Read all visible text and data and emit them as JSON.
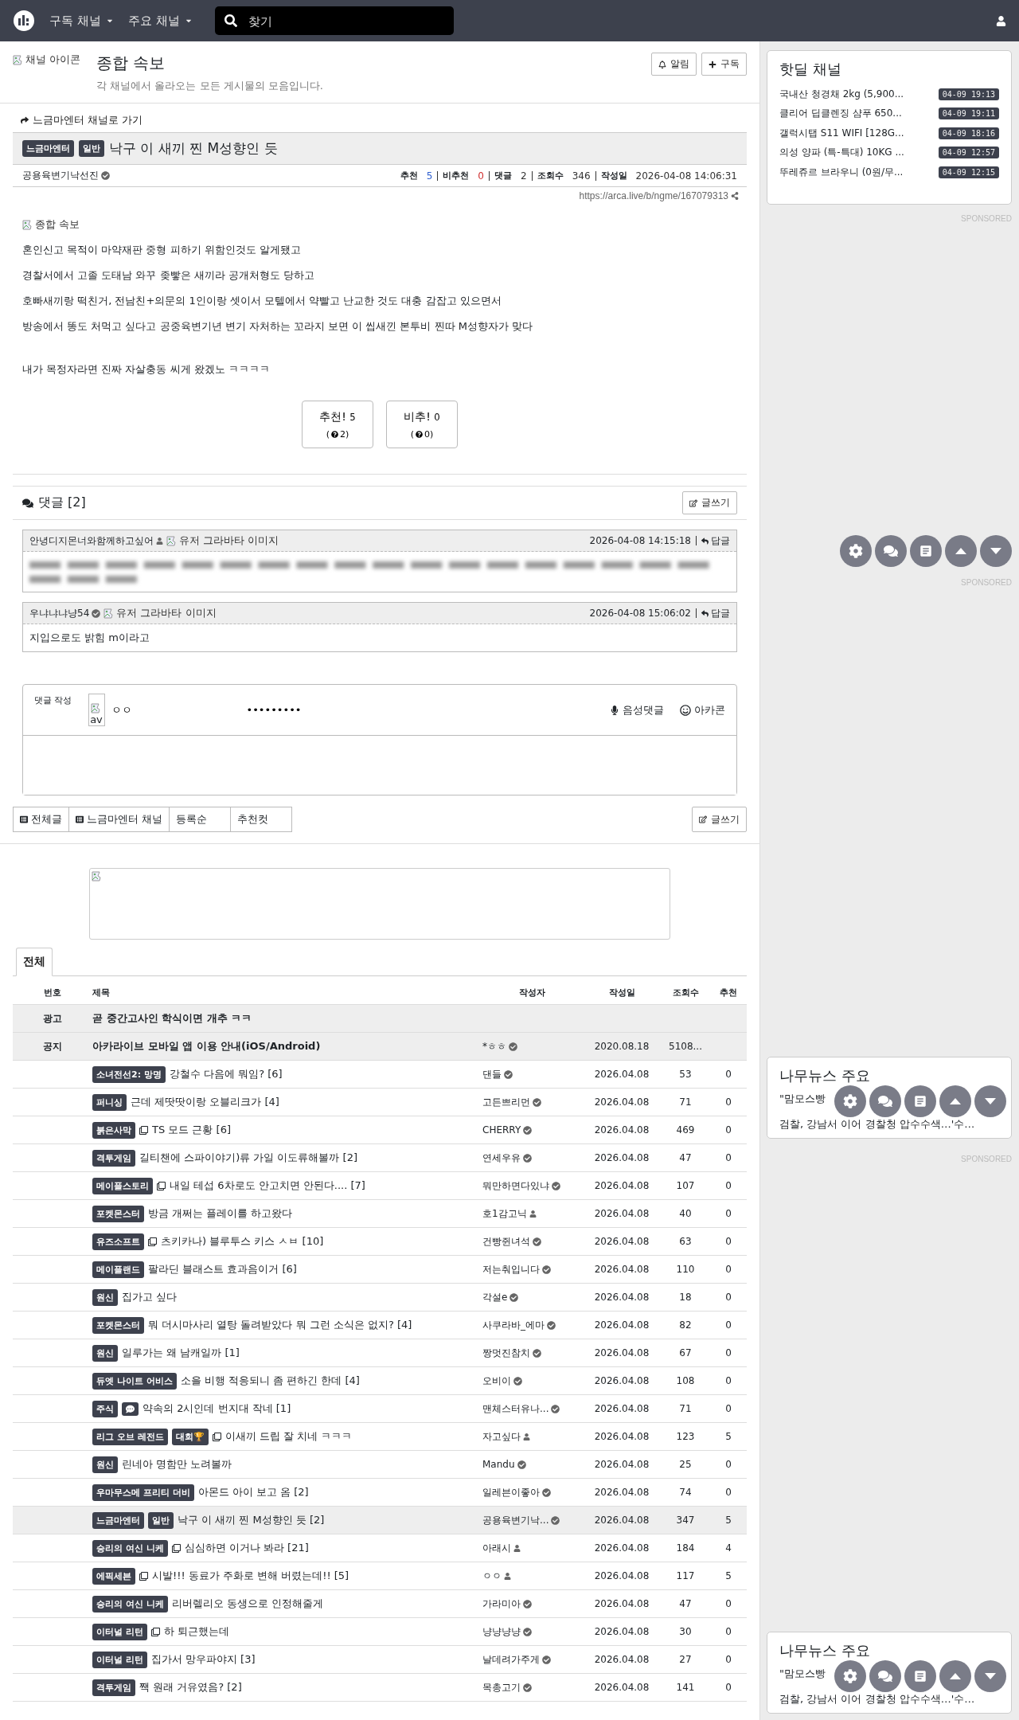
{
  "top_nav": {
    "menus": [
      "구독 채널",
      "주요 채널"
    ],
    "search": {
      "placeholder": "찾기"
    }
  },
  "channel": {
    "icon_alt": "채널 아이콘",
    "title": "종합 속보",
    "description": "각 채널에서 올라오는 모든 게시물의 모음입니다.",
    "buttons": [
      {
        "kind": "bell",
        "label": "알림"
      },
      {
        "kind": "plus",
        "label": "구독"
      }
    ]
  },
  "article": {
    "back_link": "느금마엔터 채널로 가기",
    "badges": [
      "느금마엔터",
      "일반"
    ],
    "title": "낙구 이 새끼 찐 M성향인 듯",
    "author": "공용육변기낙선진",
    "verified": true,
    "stats": [
      {
        "label": "추천",
        "value": "5",
        "kind": "up"
      },
      {
        "label": "비추천",
        "value": "0",
        "kind": "down"
      },
      {
        "label": "댓글",
        "value": "2",
        "kind": "plain"
      },
      {
        "label": "조회수",
        "value": "346",
        "kind": "plain"
      },
      {
        "label": "작성일",
        "value": "2026-04-08 14:06:31",
        "kind": "plain"
      }
    ],
    "url": "https://arca.live/b/ngme/167079313",
    "image_alt": "종합 속보",
    "paragraphs": [
      "혼인신고 목적이 마약재판 중형 피하기 위함인것도 알게됐고",
      "경찰서에서 고졸 도태남 와꾸 좆빻은 새끼라 공개처형도 당하고",
      "호빠새끼랑 떡친거, 전남친+의문의 1인이랑 셋이서 모텔에서 약빨고 난교한 것도 대충 감잡고 있으면서",
      "방송에서 똥도 처먹고 싶다고 공중육변기년 변기 자처하는 꼬라지 보면 이 씹새낀 본투비 찐따 M성향자가 맞다",
      "내가 목정자라면 진짜 자살충동 씨게 왔겠노 ㅋㅋㅋㅋ"
    ],
    "votes": [
      {
        "label": "추천!",
        "count": "5",
        "open": "(",
        "sub": "2)"
      },
      {
        "label": "비추!",
        "count": "0",
        "open": "(",
        "sub": "0)"
      }
    ]
  },
  "comments": {
    "title": "댓글 [2]",
    "write_button": "글쓰기",
    "items": [
      {
        "author": "안녕디지몬너와함께하고싶어",
        "verified": false,
        "avatar_alt": "유저 그라바타 이미지",
        "date": "2026-04-08 14:15:18",
        "reply": "답글",
        "blurred": true
      },
      {
        "author": "우냐냐냐냥54",
        "verified": true,
        "avatar_alt": "유저 그라바타 이미지",
        "date": "2026-04-08 15:06:02",
        "reply": "답글",
        "blurred": false,
        "text": "지입으로도 밝힘 m이라고"
      }
    ]
  },
  "comment_form": {
    "label": "댓글 작성",
    "avatar_alt": "av",
    "nickname": "ㅇㅇ",
    "password": "•••••••••",
    "voice": "음성댓글",
    "arcacon": "아카콘"
  },
  "bottom_tabs": {
    "items": [
      {
        "label": "전체글",
        "kind": "list"
      },
      {
        "label": "느금마엔터 채널",
        "kind": "list"
      },
      {
        "label": "등록순",
        "kind": "plain"
      },
      {
        "label": "추천컷",
        "kind": "plain"
      }
    ],
    "write_button": "글쓰기"
  },
  "board": {
    "tabs": [
      {
        "label": "전체",
        "selected": true
      }
    ],
    "columns": [
      "번호",
      "제목",
      "작성자",
      "작성일",
      "조회수",
      "추천"
    ],
    "pinned": [
      {
        "label": "광고",
        "title": "곧 중간고사인 학식이면 개추 ㅋㅋ"
      },
      {
        "label": "공지",
        "title": "아카라이브 모바일 앱 이용 안내(iOS/Android)",
        "author": "*ㅎㅎ",
        "verified": true,
        "date": "2020.08.18",
        "views": "5108..."
      }
    ],
    "rows": [
      {
        "badges": [
          {
            "kind": "text",
            "text": "소녀전선2: 망명"
          }
        ],
        "image": false,
        "title": "강철수 다음에 뭐임? [6]",
        "author": "댄들",
        "verified": true,
        "date": "2026.04.08",
        "views": "53",
        "votes": "0",
        "current": false
      },
      {
        "badges": [
          {
            "kind": "text",
            "text": "퍼니싱"
          }
        ],
        "image": false,
        "title": "근데 제땃땃이랑 오블리크가 [4]",
        "author": "고든쁘리먼",
        "verified": true,
        "date": "2026.04.08",
        "views": "71",
        "votes": "0",
        "current": false
      },
      {
        "badges": [
          {
            "kind": "text",
            "text": "붉은사막"
          }
        ],
        "image": true,
        "title": "TS 모드 근황 [6]",
        "author": "CHERRY",
        "verified": true,
        "date": "2026.04.08",
        "views": "469",
        "votes": "0",
        "current": false
      },
      {
        "badges": [
          {
            "kind": "text",
            "text": "격투게임"
          }
        ],
        "image": false,
        "title": "길티챈에 스파이야기)류 가일 이도류해볼까 [2]",
        "author": "연세우유",
        "verified": true,
        "date": "2026.04.08",
        "views": "47",
        "votes": "0",
        "current": false
      },
      {
        "badges": [
          {
            "kind": "text",
            "text": "메이플스토리"
          }
        ],
        "image": true,
        "title": "내일 테섭 6차로도 안고치면 안된다.... [7]",
        "author": "뭐만하면다있냐",
        "verified": true,
        "date": "2026.04.08",
        "views": "107",
        "votes": "0",
        "current": false
      },
      {
        "badges": [
          {
            "kind": "text",
            "text": "포켓몬스터"
          }
        ],
        "image": false,
        "title": "방금 개쩌는 플레이를 하고왔다",
        "author": "호1감고닉",
        "verified": false,
        "date": "2026.04.08",
        "views": "40",
        "votes": "0",
        "current": false
      },
      {
        "badges": [
          {
            "kind": "text",
            "text": "유즈소프트"
          }
        ],
        "image": true,
        "title": "츠키카나) 블루투스 키스 ㅅㅂ [10]",
        "author": "건빵쥔녀석",
        "verified": true,
        "date": "2026.04.08",
        "views": "63",
        "votes": "0",
        "current": false
      },
      {
        "badges": [
          {
            "kind": "text",
            "text": "메이플랜드"
          }
        ],
        "image": false,
        "title": "팔라딘 블래스트 효과음이거 [6]",
        "author": "저는춰입니다",
        "verified": true,
        "date": "2026.04.08",
        "views": "110",
        "votes": "0",
        "current": false
      },
      {
        "badges": [
          {
            "kind": "text",
            "text": "원신"
          }
        ],
        "image": false,
        "title": "집가고 싶다",
        "author": "각설e",
        "verified": true,
        "date": "2026.04.08",
        "views": "18",
        "votes": "0",
        "current": false
      },
      {
        "badges": [
          {
            "kind": "text",
            "text": "포켓몬스터"
          }
        ],
        "image": false,
        "title": "뭐 더시마사리 열탕 돌려받았다 뭐 그런 소식은 없지? [4]",
        "author": "사쿠라바_에마",
        "verified": true,
        "date": "2026.04.08",
        "views": "82",
        "votes": "0",
        "current": false
      },
      {
        "badges": [
          {
            "kind": "text",
            "text": "원신"
          }
        ],
        "image": false,
        "title": "일루가는 왜 남캐일까 [1]",
        "author": "짱멋진참치",
        "verified": true,
        "date": "2026.04.08",
        "views": "67",
        "votes": "0",
        "current": false
      },
      {
        "badges": [
          {
            "kind": "text",
            "text": "듀엣 나이트 어비스"
          }
        ],
        "image": false,
        "title": "소을 비행 적응되니 좀 편하긴 한데 [4]",
        "author": "오비이",
        "verified": true,
        "date": "2026.04.08",
        "views": "108",
        "votes": "0",
        "current": false
      },
      {
        "badges": [
          {
            "kind": "text",
            "text": "주식"
          },
          {
            "kind": "chat"
          }
        ],
        "image": false,
        "title": "약속의 2시인데 번지대 작네 [1]",
        "author": "맨체스터유나...",
        "verified": true,
        "date": "2026.04.08",
        "views": "71",
        "votes": "0",
        "current": false
      },
      {
        "badges": [
          {
            "kind": "text",
            "text": "리그 오브 레전드"
          },
          {
            "kind": "text",
            "text": "대회🏆"
          }
        ],
        "image": true,
        "title": "이새끼 드립 잘 치네 ㅋㅋㅋ",
        "author": "자고싶다",
        "verified": false,
        "date": "2026.04.08",
        "views": "123",
        "votes": "5",
        "current": false
      },
      {
        "badges": [
          {
            "kind": "text",
            "text": "원신"
          }
        ],
        "image": false,
        "title": "린네아 명함만 노려볼까",
        "author": "Mandu",
        "verified": true,
        "date": "2026.04.08",
        "views": "25",
        "votes": "0",
        "current": false
      },
      {
        "badges": [
          {
            "kind": "text",
            "text": "우마무스메 프리티 더비"
          }
        ],
        "image": false,
        "title": "아몬드 아이 보고 옴 [2]",
        "author": "일레븐이좋아",
        "verified": true,
        "date": "2026.04.08",
        "views": "74",
        "votes": "0",
        "current": false
      },
      {
        "badges": [
          {
            "kind": "text",
            "text": "느금마엔터"
          },
          {
            "kind": "text",
            "text": "일반"
          }
        ],
        "image": false,
        "title": "낙구 이 새끼 찐 M성향인 듯 [2]",
        "author": "공용육변기낙...",
        "verified": true,
        "date": "2026.04.08",
        "views": "347",
        "votes": "5",
        "current": true
      },
      {
        "badges": [
          {
            "kind": "text",
            "text": "승리의 여신 니케"
          }
        ],
        "image": true,
        "title": "심심하면 이거나 봐라 [21]",
        "author": "아래시",
        "verified": false,
        "date": "2026.04.08",
        "views": "184",
        "votes": "4",
        "current": false
      },
      {
        "badges": [
          {
            "kind": "text",
            "text": "에픽세븐"
          }
        ],
        "image": true,
        "title": "시발!!! 동료가 주화로 변해 버렸는데!! [5]",
        "author": "ㅇㅇ",
        "verified": false,
        "date": "2026.04.08",
        "views": "117",
        "votes": "5",
        "current": false
      },
      {
        "badges": [
          {
            "kind": "text",
            "text": "승리의 여신 니케"
          }
        ],
        "image": false,
        "title": "리버렐리오 동생으로 인정해줄게",
        "author": "가라미아",
        "verified": true,
        "date": "2026.04.08",
        "views": "47",
        "votes": "0",
        "current": false
      },
      {
        "badges": [
          {
            "kind": "text",
            "text": "이터널 리턴"
          }
        ],
        "image": true,
        "title": "하 퇴근했는데",
        "author": "냥냥냥냥",
        "verified": true,
        "date": "2026.04.08",
        "views": "30",
        "votes": "0",
        "current": false
      },
      {
        "badges": [
          {
            "kind": "text",
            "text": "이터널 리턴"
          }
        ],
        "image": false,
        "title": "집가서 망우파야지 [3]",
        "author": "날데려가주게",
        "verified": true,
        "date": "2026.04.08",
        "views": "27",
        "votes": "0",
        "current": false
      },
      {
        "badges": [
          {
            "kind": "text",
            "text": "격투게임"
          }
        ],
        "image": false,
        "title": "짹 원래 거유였음? [2]",
        "author": "목총고기",
        "verified": true,
        "date": "2026.04.08",
        "views": "141",
        "votes": "0",
        "current": false
      }
    ]
  },
  "sidebar": {
    "hotdeal": {
      "title": "핫딜 채널",
      "items": [
        {
          "title": "국내산 청경채 2kg (5,900...",
          "time": "04-09 19:13"
        },
        {
          "title": "클리어 딥클렌징 샴푸 650...",
          "time": "04-09 19:11"
        },
        {
          "title": "갤럭시탭 S11 WIFI [128G...",
          "time": "04-09 18:16"
        },
        {
          "title": "의성 양파 (특-특대) 10KG ...",
          "time": "04-09 12:57"
        },
        {
          "title": "뚜레쥬르 브라우니 (0원/무...",
          "time": "04-09 12:15"
        }
      ]
    },
    "sponsored": [
      "SPONSORED",
      "SPONSORED",
      "SPONSORED"
    ],
    "news": [
      {
        "title": "나무뉴스 주요",
        "items": [
          "\"맘모스빵",
          "검찰, 강남서 이어 경찰청 압수수색…'수…"
        ]
      },
      {
        "title": "나무뉴스 주요",
        "items": [
          "\"맘모스빵",
          "검찰, 강남서 이어 경찰청 압수수색…'수…"
        ]
      }
    ]
  }
}
